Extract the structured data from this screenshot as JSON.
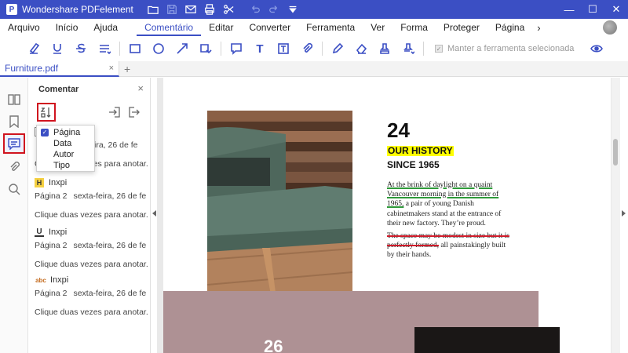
{
  "window": {
    "app_title": "Wondershare PDFelement",
    "controls": {
      "minimize": "—",
      "maximize": "☐",
      "close": "✕"
    }
  },
  "quick_access": [
    "folder-icon",
    "save-icon",
    "mail-icon",
    "print-icon",
    "scissors-icon",
    "undo-icon",
    "redo-icon",
    "dropdown-icon"
  ],
  "menu": {
    "items": [
      "Arquivo",
      "Início",
      "Ajuda",
      "Comentário",
      "Editar",
      "Converter",
      "Ferramenta",
      "Ver",
      "Forma",
      "Proteger",
      "Página"
    ],
    "active": "Comentário",
    "more": "›"
  },
  "toolbar": {
    "keep_tool_label": "Manter a ferramenta selecionada",
    "text_box_glyph": "T",
    "note_glyph": "T"
  },
  "tabs": [
    {
      "label": "Furniture.pdf",
      "close": "×"
    }
  ],
  "add_tab": "+",
  "panel": {
    "title": "Comentar",
    "close": "×",
    "sort_options": [
      {
        "label": "Página",
        "checked": true
      },
      {
        "label": "Data",
        "checked": false
      },
      {
        "label": "Autor",
        "checked": false
      },
      {
        "label": "Tipo",
        "checked": false
      }
    ],
    "comments": [
      {
        "type": "note",
        "author": "",
        "date": "ira, 26 de fe",
        "hint": "Clique duas vezes para anotar."
      },
      {
        "type": "highlight",
        "icon_text": "H",
        "author": "Inxpi",
        "page": "Página 2",
        "date": "sexta-feira, 26 de fe",
        "hint": "Clique duas vezes para anotar."
      },
      {
        "type": "underline",
        "icon_text": "U",
        "author": "Inxpi",
        "page": "Página 2",
        "date": "sexta-feira, 26 de fe",
        "hint": "Clique duas vezes para anotar."
      },
      {
        "type": "strikethrough",
        "icon_text": "abc",
        "author": "Inxpi",
        "page": "Página 2",
        "date": "sexta-feira, 26 de fe",
        "hint": "Clique duas vezes para anotar."
      }
    ]
  },
  "document": {
    "page_number": "24",
    "history_heading": "OUR HISTORY",
    "since": "SINCE 1965",
    "p1_underlined": "At the brink of daylight on a quaint Vancouver morning in the summer of 1965,",
    "p1_rest": " a pair of young Danish cabinetmakers stand at the entrance of their new factory. They’re proud.",
    "p2_struck": "The space may be modest in size but it is perfectly formed,",
    "p2_rest": " all painstakingly built by their hands.",
    "next_page_number": "26"
  },
  "colors": {
    "accent": "#3b4fc4",
    "annotation_box": "#d0141f",
    "highlight": "#ffff00",
    "underline": "#2f9a3a",
    "strike": "#d01b2a",
    "band": "#ae9194"
  }
}
